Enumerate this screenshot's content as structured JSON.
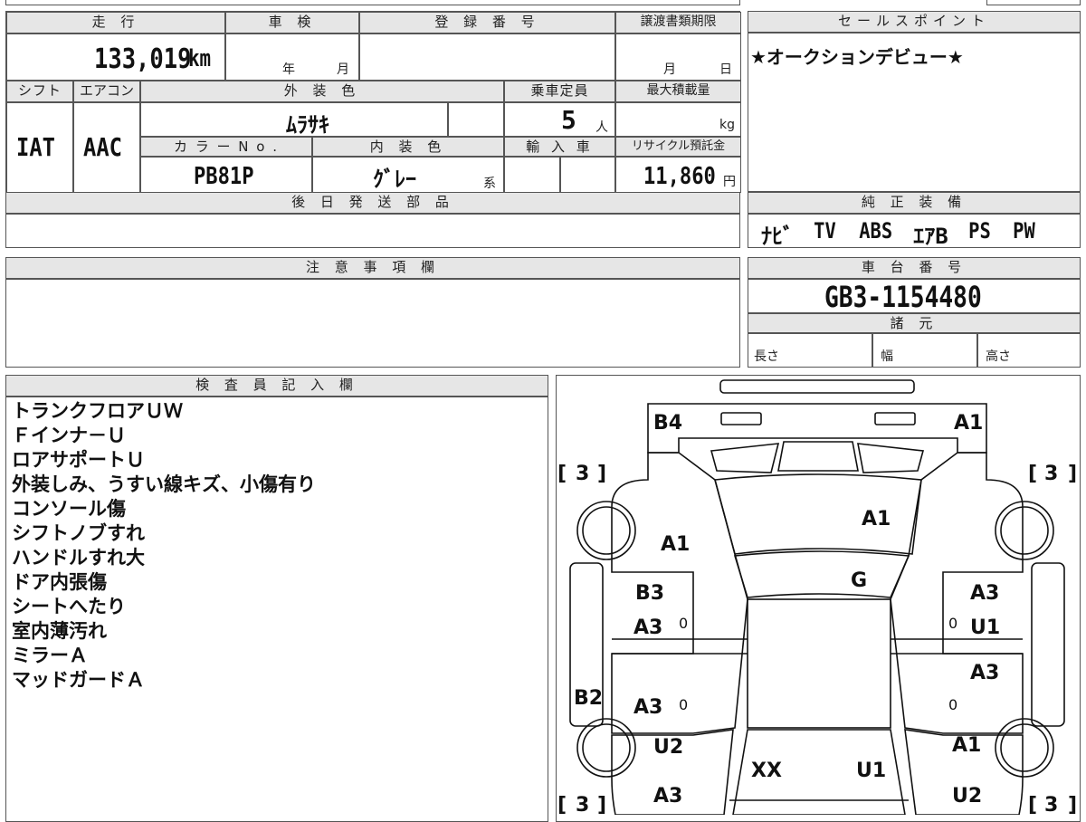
{
  "top": {
    "mileage_header": "走 行",
    "shaken_header": "車 検",
    "reg_no_header": "登 録 番 号",
    "transfer_header": "譲渡書類期限",
    "sales_header": "セールスポイント",
    "mileage_value": "133,019",
    "mileage_unit": "km",
    "year_label": "年",
    "month_label": "月",
    "transfer_month": "月",
    "transfer_day": "日",
    "sales_point": "★オークションデビュー★"
  },
  "specs": {
    "shift_header": "シフト",
    "ac_header": "エアコン",
    "exterior_header": "外 装 色",
    "capacity_header": "乗車定員",
    "max_load_header": "最大積載量",
    "shift_value": "IAT",
    "ac_value": "AAC",
    "exterior_value": "ﾑﾗｻｷ",
    "capacity_value": "5",
    "capacity_unit": "人",
    "max_load_unit": "kg",
    "color_no_header": "カ ラ ー N o .",
    "interior_header": "内 装 色",
    "import_header": "輸 入 車",
    "recycle_header": "リサイクル預託金",
    "color_no_value": "PB81P",
    "interior_value": "ｸﾞﾚｰ",
    "interior_suffix": "系",
    "recycle_value": "11,860",
    "recycle_unit": "円"
  },
  "later_parts_header": "後 日 発 送 部 品",
  "equipment": {
    "header": "純 正 装 備",
    "items": [
      "ﾅﾋﾞ",
      "TV",
      "ABS",
      "ｴｱB",
      "PS",
      "PW"
    ]
  },
  "notes_header": "注 意 事 項 欄",
  "chassis": {
    "header": "車 台 番 号",
    "value": "GB3-1154480"
  },
  "dimensions": {
    "header": "諸 元",
    "length": "長さ",
    "width": "幅",
    "height": "高さ"
  },
  "inspector": {
    "header": "検 査 員 記 入 欄",
    "lines": [
      "トランクフロアＵＷ",
      "Ｆインナ－Ｕ",
      "ロアサポートＵ",
      "外装しみ、うすい線キズ、小傷有り",
      "コンソール傷",
      "シフトノブすれ",
      "ハンドルすれ大",
      "ドア内張傷",
      "シートへたり",
      "室内薄汚れ",
      "ミラーＡ",
      "マッドガードＡ"
    ]
  },
  "diagram": {
    "labels": {
      "rear_left": "B4",
      "rear_right": "A1",
      "trunk": "A1",
      "rear_quarter_left": "A1",
      "rear_glass": "G",
      "rear_door_left_top": "B3",
      "rear_door_left_bottom": "A3",
      "rear_door_right_top": "A3",
      "rear_door_right_bottom": "U1",
      "front_door_left": "A3",
      "rocker_left": "B2",
      "front_door_right": "A3",
      "fender_left": "U2",
      "fender_right": "A1",
      "hood_left": "XX",
      "hood_right": "U1",
      "front_left": "A3",
      "front_right": "U2"
    },
    "tire_tread": [
      "3",
      "3",
      "3",
      "3"
    ],
    "zero_marks": [
      "0",
      "0",
      "0",
      "0"
    ]
  }
}
